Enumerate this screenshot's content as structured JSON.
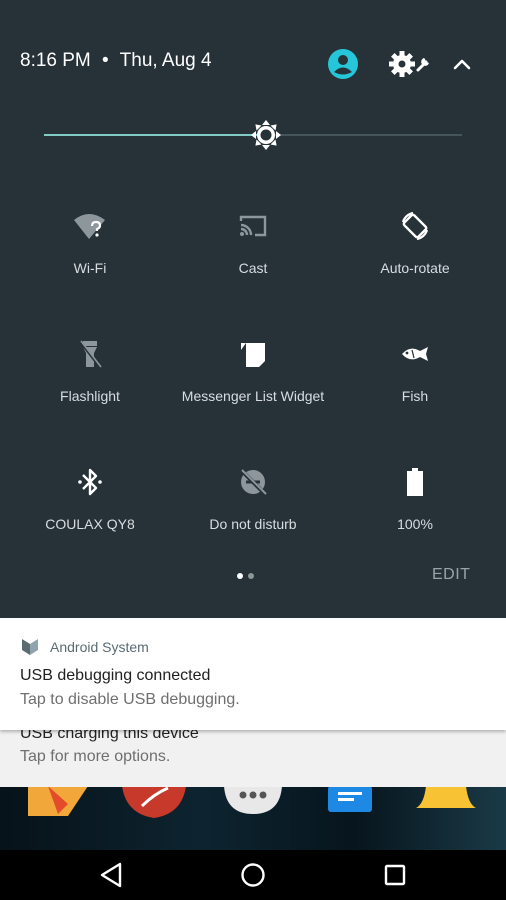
{
  "status": {
    "time": "8:16 PM",
    "separator": "•",
    "date": "Thu, Aug 4"
  },
  "header_icons": [
    "user-avatar-icon",
    "settings-wrench-icon",
    "collapse-chevron-icon"
  ],
  "brightness": {
    "level": 0.53,
    "accent": "#80cbc4"
  },
  "tiles": [
    {
      "label": "Wi-Fi",
      "icon": "wifi-unknown-icon"
    },
    {
      "label": "Cast",
      "icon": "cast-icon"
    },
    {
      "label": "Auto-rotate",
      "icon": "auto-rotate-icon"
    },
    {
      "label": "Flashlight",
      "icon": "flashlight-icon"
    },
    {
      "label": "Messenger List Widget",
      "icon": "messenger-widget-icon"
    },
    {
      "label": "Fish",
      "icon": "fish-icon"
    },
    {
      "label": "COULAX QY8",
      "icon": "bluetooth-icon"
    },
    {
      "label": "Do not disturb",
      "icon": "do-not-disturb-icon"
    },
    {
      "label": "100%",
      "icon": "battery-icon"
    }
  ],
  "pager": {
    "pages": 2,
    "current": 1
  },
  "edit_label": "EDIT",
  "notifications": [
    {
      "app": "Android System",
      "title": "USB debugging connected",
      "text": "Tap to disable USB debugging."
    },
    {
      "title": "USB charging this device",
      "text": "Tap for more options."
    }
  ],
  "colors": {
    "panel": "#263238",
    "accent": "#80cbc4",
    "avatar": "#26c6da",
    "tile_text": "#d7dde0"
  }
}
